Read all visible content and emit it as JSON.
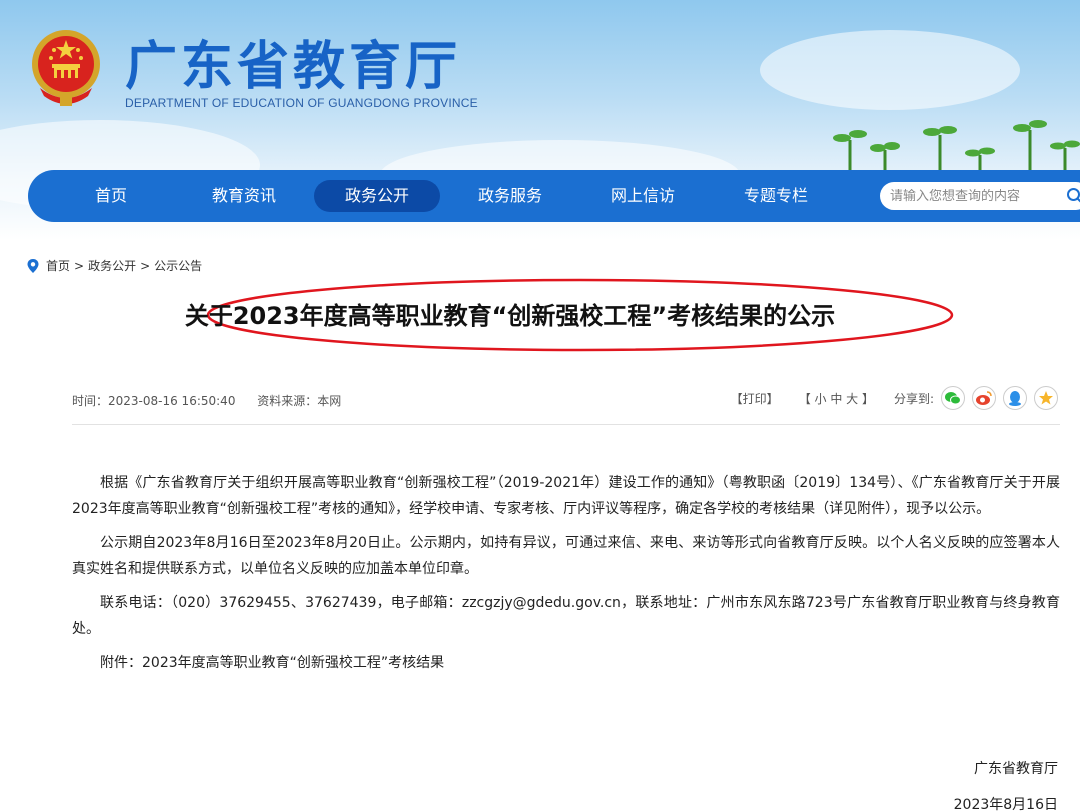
{
  "header": {
    "title": "广东省教育厅",
    "subtitle": "DEPARTMENT OF EDUCATION OF GUANGDONG PROVINCE"
  },
  "nav": {
    "items": [
      "首页",
      "教育资讯",
      "政务公开",
      "政务服务",
      "网上信访",
      "专题专栏"
    ],
    "active_index": 2,
    "search_placeholder": "请输入您想查询的内容"
  },
  "breadcrumb": [
    "首页",
    ">",
    "政务公开",
    ">",
    "公示公告"
  ],
  "article": {
    "title": "关于2023年度高等职业教育“创新强校工程”考核结果的公示",
    "time": "时间：2023-08-16 16:50:40",
    "source": "资料来源：本网",
    "print": "【打印】",
    "font_size": "【 小  中  大 】",
    "share": "分享到:",
    "paragraphs": [
      "根据《广东省教育厅关于组织开展高等职业教育“创新强校工程”（2019-2021年）建设工作的通知》（粤教职函〔2019〕134号）、《广东省教育厅关于开展2023年度高等职业教育“创新强校工程”考核的通知》，经学校申请、专家考核、厅内评议等程序，确定各学校的考核结果（详见附件），现予以公示。",
      "公示期自2023年8月16日至2023年8月20日止。公示期内，如持有异议，可通过来信、来电、来访等形式向省教育厅反映。以个人名义反映的应签署本人真实姓名和提供联系方式，以单位名义反映的应加盖本单位印章。",
      "联系电话：（020）37629455、37627439，电子邮箱：zzcgzjy@gdedu.gov.cn，联系地址：广州市东风东路723号广东省教育厅职业教育与终身教育处。",
      "附件：2023年度高等职业教育“创新强校工程”考核结果"
    ],
    "signature_org": "广东省教育厅",
    "signature_date": "2023年8月16日"
  },
  "colors": {
    "brand_blue": "#1b6fd1",
    "nav_active": "#0c4aa6",
    "annotation_red": "#e0161e"
  },
  "icons": [
    "national-emblem-icon",
    "search-icon",
    "location-pin-icon",
    "wechat-icon",
    "weibo-icon",
    "qq-icon",
    "qzone-icon"
  ]
}
